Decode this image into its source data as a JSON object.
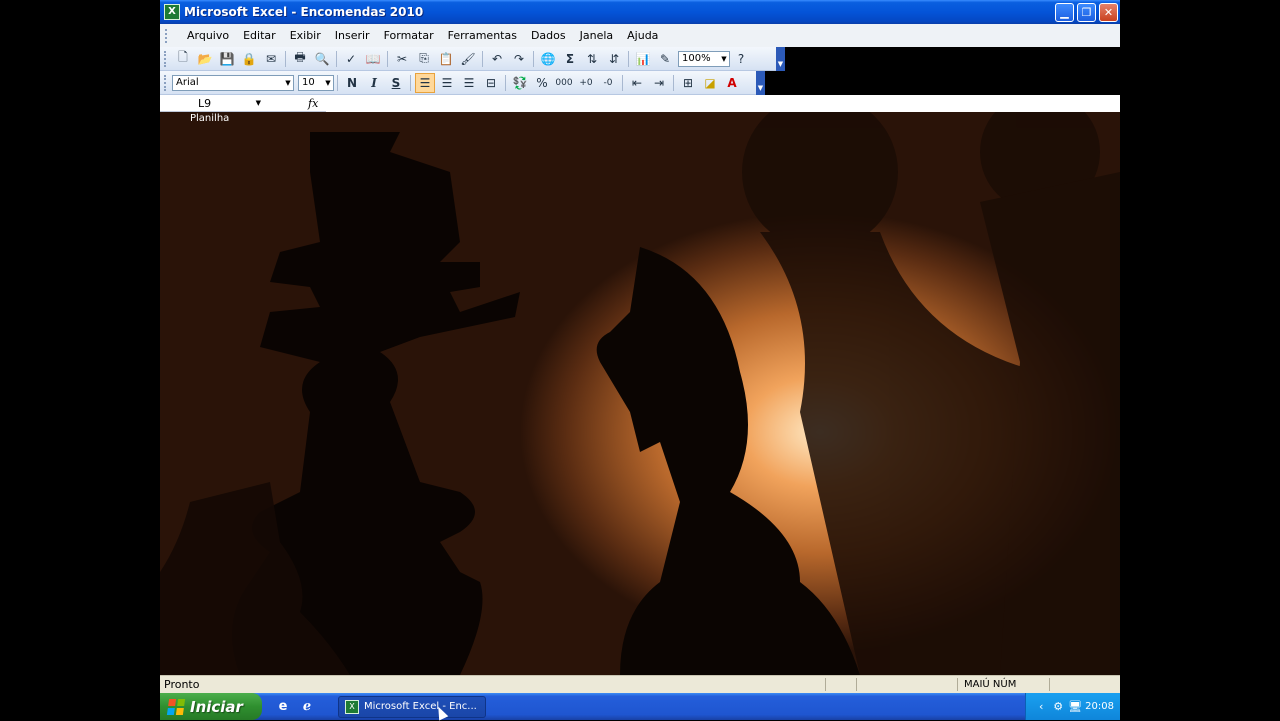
{
  "window": {
    "title": "Microsoft Excel - Encomendas 2010",
    "app_icon_glyph": "X",
    "minimize_icon": "minimize-icon",
    "restore_icon": "restore-icon",
    "close_icon": "close-icon"
  },
  "menu": {
    "items": [
      "Arquivo",
      "Editar",
      "Exibir",
      "Inserir",
      "Formatar",
      "Ferramentas",
      "Dados",
      "Janela",
      "Ajuda"
    ]
  },
  "standard_toolbar": {
    "zoom": "100%",
    "sum_glyph": "Σ"
  },
  "format_toolbar": {
    "font": "Arial",
    "size": "10",
    "bold": "N",
    "italic": "I",
    "underline": "S",
    "percent": "%",
    "thousands": "000"
  },
  "formula_bar": {
    "name_box": "L9",
    "fx_label": "fx",
    "formula": ""
  },
  "workspace": {
    "label": "Planilha"
  },
  "status_bar": {
    "status": "Pronto",
    "indicators": "MAIÚ NÚM"
  },
  "taskbar": {
    "start_label": "Iniciar",
    "task_label": "Microsoft Excel - Enc...",
    "clock": "20:08"
  },
  "colors": {
    "titlebar": "#0454d8",
    "taskbar": "#245edb",
    "start": "#2f8f2f",
    "menubar": "#eef2f6",
    "status": "#ece9d8"
  }
}
